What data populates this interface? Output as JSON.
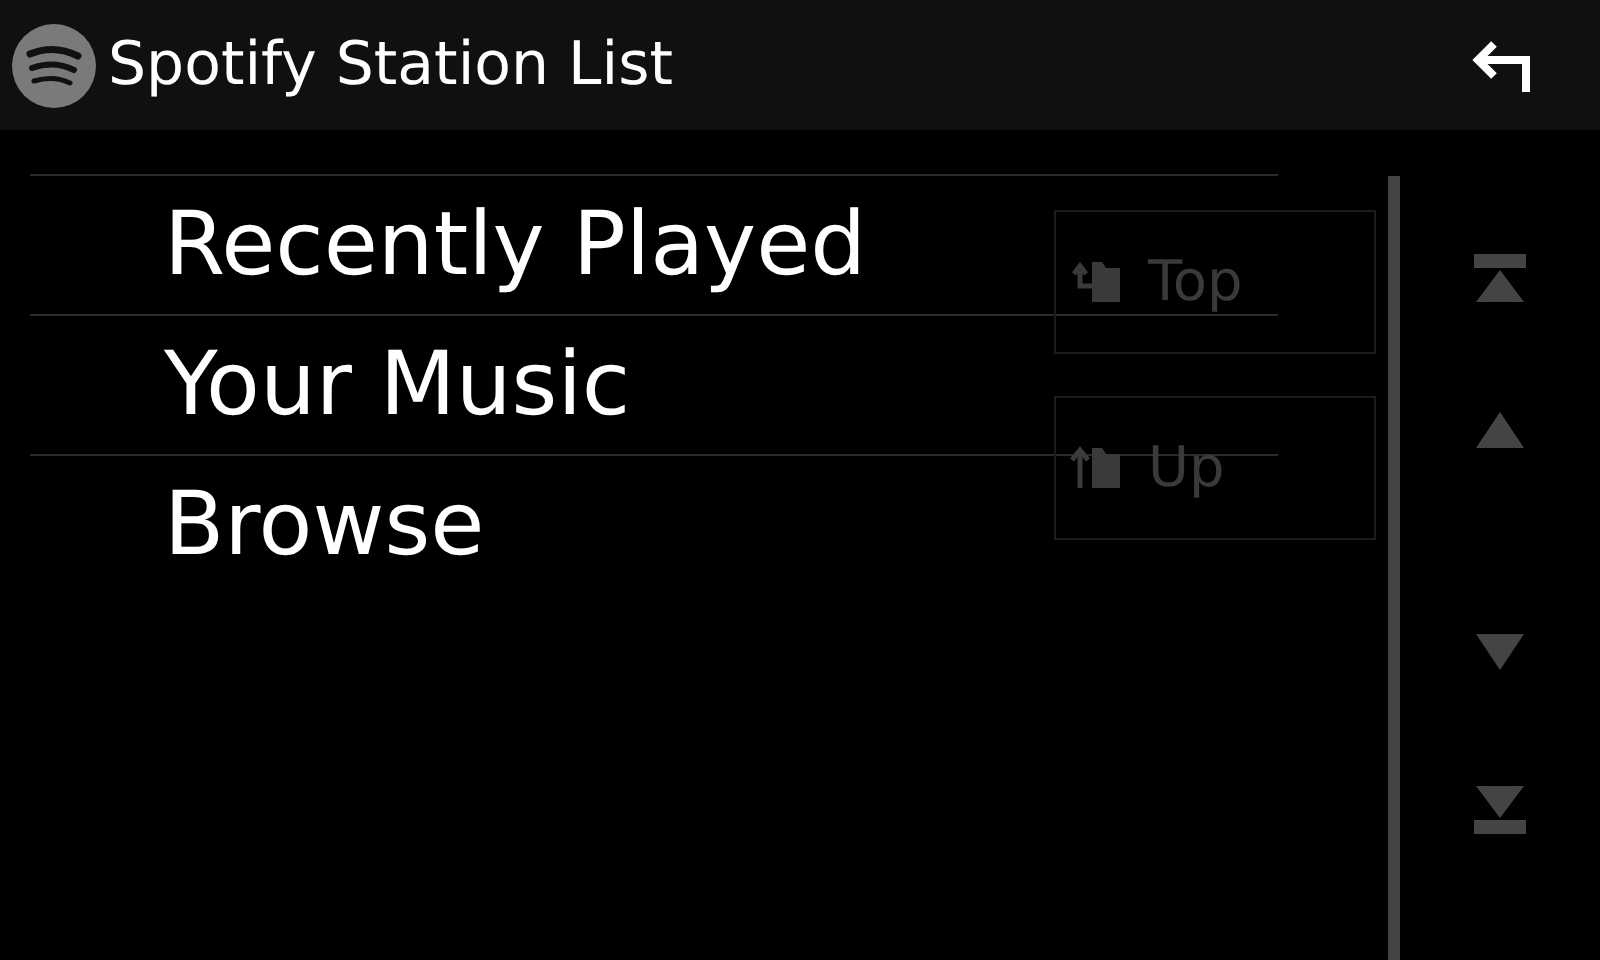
{
  "header": {
    "title": "Spotify Station List"
  },
  "list": {
    "items": [
      {
        "label": "Recently Played"
      },
      {
        "label": "Your Music"
      },
      {
        "label": "Browse"
      }
    ]
  },
  "nav_buttons": [
    {
      "kind": "top",
      "label": "Top",
      "disabled": true
    },
    {
      "kind": "up",
      "label": "Up",
      "disabled": true
    }
  ]
}
